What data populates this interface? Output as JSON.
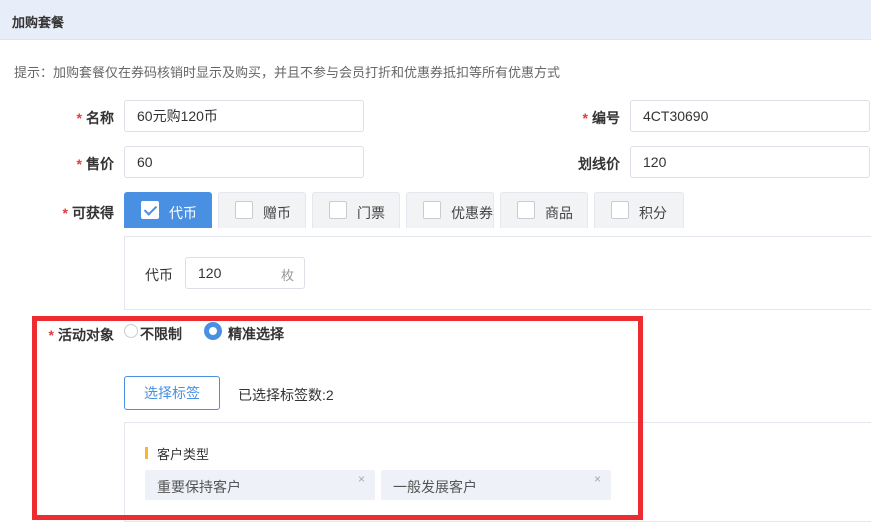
{
  "header": {
    "title": "加购套餐"
  },
  "tip": "提示：加购套餐仅在券码核销时显示及购买，并且不参与会员打折和优惠券抵扣等所有优惠方式",
  "required_mark": "*",
  "form": {
    "name_label": "名称",
    "name_value": "60元购120币",
    "code_label": "编号",
    "code_value": "4CT30690",
    "price_label": "售价",
    "price_value": "60",
    "strike_label": "划线价",
    "strike_value": "120",
    "obtain_label": "可获得"
  },
  "tabs": [
    {
      "label": "代币",
      "checked": true
    },
    {
      "label": "赠币",
      "checked": false
    },
    {
      "label": "门票",
      "checked": false
    },
    {
      "label": "优惠券",
      "checked": false
    },
    {
      "label": "商品",
      "checked": false
    },
    {
      "label": "积分",
      "checked": false
    }
  ],
  "coin": {
    "label": "代币",
    "value": "120",
    "unit": "枚"
  },
  "target": {
    "label": "活动对象",
    "options": [
      {
        "label": "不限制",
        "checked": false
      },
      {
        "label": "精准选择",
        "checked": true
      }
    ],
    "select_button": "选择标签",
    "selected_count": "已选择标签数:2",
    "group_title": "客户类型",
    "chips": [
      "重要保持客户",
      "一般发展客户"
    ],
    "chip_close": "×"
  },
  "colors": {
    "accent": "#4a90e2",
    "required": "#e23c3c",
    "highlight": "#ec2c31",
    "group_bar": "#f5b82e"
  },
  "icons": {
    "check": "check-icon",
    "close": "close-icon"
  }
}
